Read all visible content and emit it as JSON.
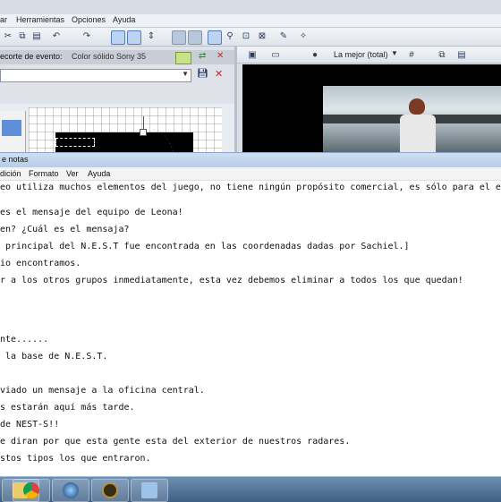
{
  "vegas": {
    "menu": [
      "ar",
      "Herramientas",
      "Opciones",
      "Ayuda"
    ],
    "event_panel": {
      "title": "ecorte de evento:",
      "preset": "Color sólido Sony 35"
    },
    "preview": {
      "quality": "La mejor (total)"
    }
  },
  "notepad": {
    "title": "e notas",
    "menu": [
      "dición",
      "Formato",
      "Ver",
      "Ayuda"
    ],
    "lines": [
      "eo utiliza muchos elementos del juego, no tiene ningún propósito comercial, es sólo para el entre",
      "",
      "es el mensaje del equipo de Leona!",
      "en? ¿Cuál es el mensaja?",
      " principal del N.E.S.T fue encontrada en las coordenadas dadas por Sachiel.]",
      "io encontramos.",
      "r a los otros grupos inmediatamente, esta vez debemos eliminar a todos los que quedan!",
      "",
      "",
      "",
      "nte......",
      " la base de N.E.S.T.",
      "",
      "viado un mensaje a la oficina central.",
      "s estarán aquí más tarde.",
      "de NEST-S!!",
      "e diran por que esta gente esta del exterior de nuestros radares.",
      "stos tipos los que entraron."
    ]
  },
  "taskbar": {
    "apps": [
      {
        "icon": "windows-explorer-icon",
        "color": "#e8c04a"
      },
      {
        "icon": "chrome-icon",
        "color": "#3f9a3a"
      },
      {
        "icon": "vegas-icon",
        "color": "#2d3e5e"
      },
      {
        "icon": "league-of-legends-icon",
        "color": "#b59440"
      },
      {
        "icon": "notepad-icon",
        "color": "#9fc2e8"
      }
    ]
  }
}
